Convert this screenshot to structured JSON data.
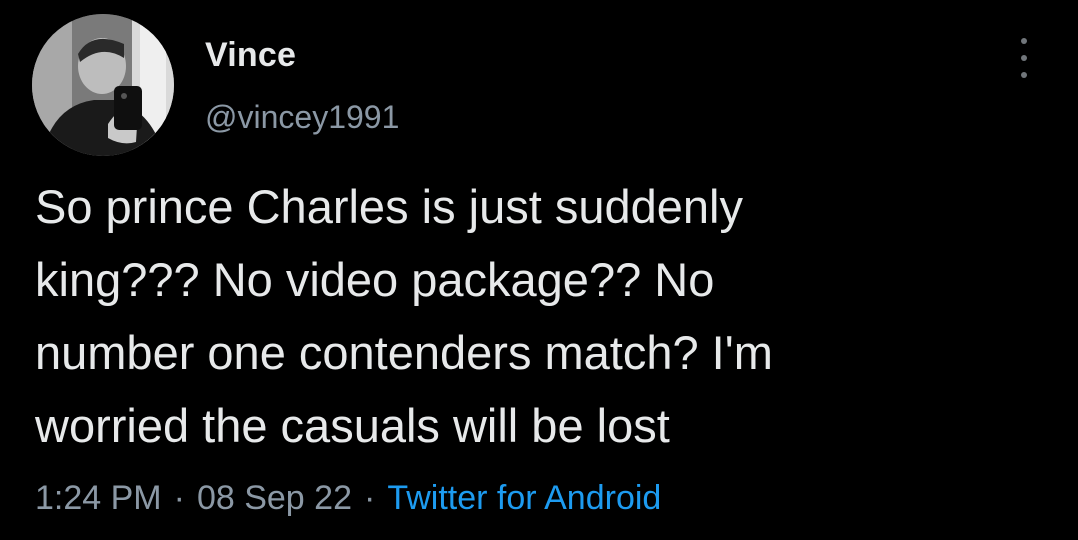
{
  "tweet": {
    "display_name": "Vince",
    "handle": "@vincey1991",
    "text": "So prince Charles is just suddenly\nking??? No video package?? No\nnumber one contenders match? I'm\nworried the casuals will be lost",
    "time": "1:24 PM",
    "separator": "·",
    "date": "08 Sep 22",
    "source": "Twitter for Android"
  },
  "icons": {
    "more": "more-options-icon",
    "avatar": "avatar"
  },
  "colors": {
    "background": "#000000",
    "primary_text": "#e7e9ea",
    "secondary_text": "#8b98a5",
    "link": "#1d9bf0"
  }
}
